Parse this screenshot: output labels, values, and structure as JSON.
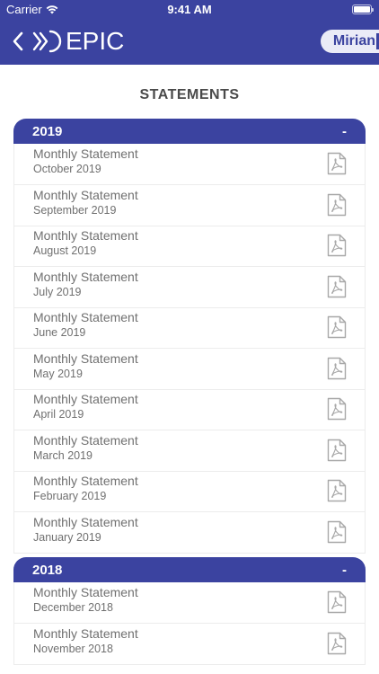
{
  "status_bar": {
    "carrier": "Carrier",
    "time": "9:41 AM"
  },
  "header": {
    "logo_text": "EPIC",
    "user_name": "Mirian",
    "background": "#3b43a0"
  },
  "page_title": "STATEMENTS",
  "sections": [
    {
      "year": "2019",
      "toggle": "-",
      "items": [
        {
          "title": "Monthly Statement",
          "date": "October 2019"
        },
        {
          "title": "Monthly Statement",
          "date": "September 2019"
        },
        {
          "title": "Monthly Statement",
          "date": "August 2019"
        },
        {
          "title": "Monthly Statement",
          "date": "July 2019"
        },
        {
          "title": "Monthly Statement",
          "date": "June 2019"
        },
        {
          "title": "Monthly Statement",
          "date": "May 2019"
        },
        {
          "title": "Monthly Statement",
          "date": "April 2019"
        },
        {
          "title": "Monthly Statement",
          "date": "March 2019"
        },
        {
          "title": "Monthly Statement",
          "date": "February 2019"
        },
        {
          "title": "Monthly Statement",
          "date": "January 2019"
        }
      ]
    },
    {
      "year": "2018",
      "toggle": "-",
      "items": [
        {
          "title": "Monthly Statement",
          "date": "December 2018"
        },
        {
          "title": "Monthly Statement",
          "date": "November 2018"
        }
      ]
    }
  ],
  "icons": {
    "row_action": "pdf-file-icon",
    "back": "chevron-left-icon",
    "wifi": "wifi-icon",
    "battery": "battery-icon"
  }
}
